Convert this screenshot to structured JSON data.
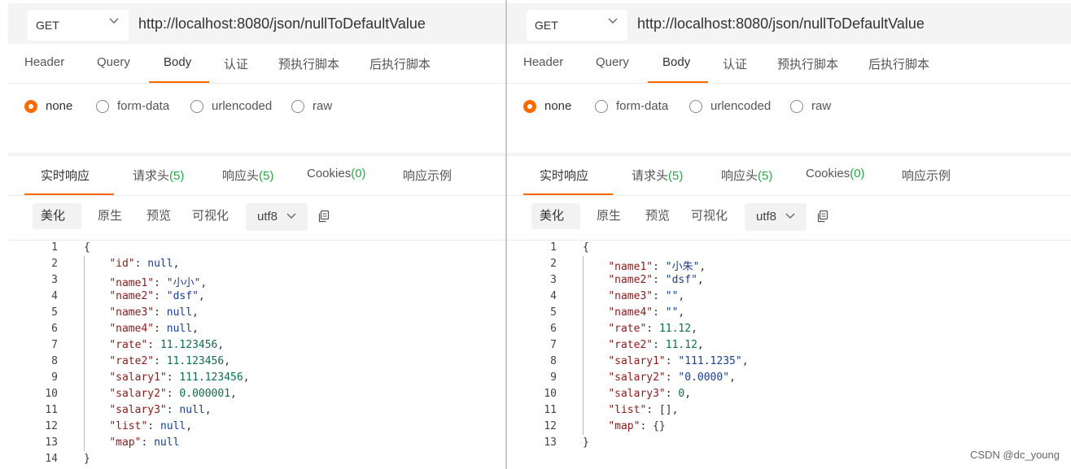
{
  "left": {
    "method": "GET",
    "url": "http://localhost:8080/json/nullToDefaultValue",
    "request_tabs": [
      {
        "label": "Header"
      },
      {
        "label": "Query"
      },
      {
        "label": "Body"
      },
      {
        "label": "认证"
      },
      {
        "label": "预执行脚本"
      },
      {
        "label": "后执行脚本"
      }
    ],
    "active_request_tab": "Body",
    "body_types": [
      {
        "label": "none"
      },
      {
        "label": "form-data"
      },
      {
        "label": "urlencoded"
      },
      {
        "label": "raw"
      }
    ],
    "selected_body_type": "none",
    "response_tabs": [
      {
        "label": "实时响应",
        "count": ""
      },
      {
        "label": "请求头",
        "count": "(5)"
      },
      {
        "label": "响应头",
        "count": "(5)"
      },
      {
        "label": "Cookies",
        "count": "(0)"
      },
      {
        "label": "响应示例",
        "count": ""
      }
    ],
    "active_response_tab": "实时响应",
    "view_buttons": [
      {
        "label": "美化"
      },
      {
        "label": "原生"
      },
      {
        "label": "预览"
      },
      {
        "label": "可视化"
      }
    ],
    "active_view": "美化",
    "encoding": "utf8",
    "code_lines": [
      {
        "num": "1",
        "tokens": [
          {
            "t": "p",
            "v": "{"
          }
        ]
      },
      {
        "num": "2",
        "tokens": [
          {
            "t": "p",
            "v": "    "
          },
          {
            "t": "k",
            "v": "\"id\""
          },
          {
            "t": "p",
            "v": ": "
          },
          {
            "t": "nl",
            "v": "null"
          },
          {
            "t": "p",
            "v": ","
          }
        ]
      },
      {
        "num": "3",
        "tokens": [
          {
            "t": "p",
            "v": "    "
          },
          {
            "t": "k",
            "v": "\"name1\""
          },
          {
            "t": "p",
            "v": ": "
          },
          {
            "t": "s",
            "v": "\"小小\""
          },
          {
            "t": "p",
            "v": ","
          }
        ]
      },
      {
        "num": "4",
        "tokens": [
          {
            "t": "p",
            "v": "    "
          },
          {
            "t": "k",
            "v": "\"name2\""
          },
          {
            "t": "p",
            "v": ": "
          },
          {
            "t": "s",
            "v": "\"dsf\""
          },
          {
            "t": "p",
            "v": ","
          }
        ]
      },
      {
        "num": "5",
        "tokens": [
          {
            "t": "p",
            "v": "    "
          },
          {
            "t": "k",
            "v": "\"name3\""
          },
          {
            "t": "p",
            "v": ": "
          },
          {
            "t": "nl",
            "v": "null"
          },
          {
            "t": "p",
            "v": ","
          }
        ]
      },
      {
        "num": "6",
        "tokens": [
          {
            "t": "p",
            "v": "    "
          },
          {
            "t": "k",
            "v": "\"name4\""
          },
          {
            "t": "p",
            "v": ": "
          },
          {
            "t": "nl",
            "v": "null"
          },
          {
            "t": "p",
            "v": ","
          }
        ]
      },
      {
        "num": "7",
        "tokens": [
          {
            "t": "p",
            "v": "    "
          },
          {
            "t": "k",
            "v": "\"rate\""
          },
          {
            "t": "p",
            "v": ": "
          },
          {
            "t": "n",
            "v": "11.123456"
          },
          {
            "t": "p",
            "v": ","
          }
        ]
      },
      {
        "num": "8",
        "tokens": [
          {
            "t": "p",
            "v": "    "
          },
          {
            "t": "k",
            "v": "\"rate2\""
          },
          {
            "t": "p",
            "v": ": "
          },
          {
            "t": "n",
            "v": "11.123456"
          },
          {
            "t": "p",
            "v": ","
          }
        ]
      },
      {
        "num": "9",
        "tokens": [
          {
            "t": "p",
            "v": "    "
          },
          {
            "t": "k",
            "v": "\"salary1\""
          },
          {
            "t": "p",
            "v": ": "
          },
          {
            "t": "n",
            "v": "111.123456"
          },
          {
            "t": "p",
            "v": ","
          }
        ]
      },
      {
        "num": "10",
        "tokens": [
          {
            "t": "p",
            "v": "    "
          },
          {
            "t": "k",
            "v": "\"salary2\""
          },
          {
            "t": "p",
            "v": ": "
          },
          {
            "t": "n",
            "v": "0.000001"
          },
          {
            "t": "p",
            "v": ","
          }
        ]
      },
      {
        "num": "11",
        "tokens": [
          {
            "t": "p",
            "v": "    "
          },
          {
            "t": "k",
            "v": "\"salary3\""
          },
          {
            "t": "p",
            "v": ": "
          },
          {
            "t": "nl",
            "v": "null"
          },
          {
            "t": "p",
            "v": ","
          }
        ]
      },
      {
        "num": "12",
        "tokens": [
          {
            "t": "p",
            "v": "    "
          },
          {
            "t": "k",
            "v": "\"list\""
          },
          {
            "t": "p",
            "v": ": "
          },
          {
            "t": "nl",
            "v": "null"
          },
          {
            "t": "p",
            "v": ","
          }
        ]
      },
      {
        "num": "13",
        "tokens": [
          {
            "t": "p",
            "v": "    "
          },
          {
            "t": "k",
            "v": "\"map\""
          },
          {
            "t": "p",
            "v": ": "
          },
          {
            "t": "nl",
            "v": "null"
          }
        ]
      },
      {
        "num": "14",
        "tokens": [
          {
            "t": "p",
            "v": "}"
          }
        ]
      }
    ]
  },
  "right": {
    "method": "GET",
    "url": "http://localhost:8080/json/nullToDefaultValue",
    "request_tabs": [
      {
        "label": "Header"
      },
      {
        "label": "Query"
      },
      {
        "label": "Body"
      },
      {
        "label": "认证"
      },
      {
        "label": "预执行脚本"
      },
      {
        "label": "后执行脚本"
      }
    ],
    "active_request_tab": "Body",
    "body_types": [
      {
        "label": "none"
      },
      {
        "label": "form-data"
      },
      {
        "label": "urlencoded"
      },
      {
        "label": "raw"
      }
    ],
    "selected_body_type": "none",
    "response_tabs": [
      {
        "label": "实时响应",
        "count": ""
      },
      {
        "label": "请求头",
        "count": "(5)"
      },
      {
        "label": "响应头",
        "count": "(5)"
      },
      {
        "label": "Cookies",
        "count": "(0)"
      },
      {
        "label": "响应示例",
        "count": ""
      }
    ],
    "active_response_tab": "实时响应",
    "view_buttons": [
      {
        "label": "美化"
      },
      {
        "label": "原生"
      },
      {
        "label": "预览"
      },
      {
        "label": "可视化"
      }
    ],
    "active_view": "美化",
    "encoding": "utf8",
    "code_lines": [
      {
        "num": "1",
        "tokens": [
          {
            "t": "p",
            "v": "{"
          }
        ]
      },
      {
        "num": "2",
        "tokens": [
          {
            "t": "p",
            "v": "    "
          },
          {
            "t": "k",
            "v": "\"name1\""
          },
          {
            "t": "p",
            "v": ": "
          },
          {
            "t": "s",
            "v": "\"小朱\""
          },
          {
            "t": "p",
            "v": ","
          }
        ]
      },
      {
        "num": "3",
        "tokens": [
          {
            "t": "p",
            "v": "    "
          },
          {
            "t": "k",
            "v": "\"name2\""
          },
          {
            "t": "p",
            "v": ": "
          },
          {
            "t": "s",
            "v": "\"dsf\""
          },
          {
            "t": "p",
            "v": ","
          }
        ]
      },
      {
        "num": "4",
        "tokens": [
          {
            "t": "p",
            "v": "    "
          },
          {
            "t": "k",
            "v": "\"name3\""
          },
          {
            "t": "p",
            "v": ": "
          },
          {
            "t": "s",
            "v": "\"\""
          },
          {
            "t": "p",
            "v": ","
          }
        ]
      },
      {
        "num": "5",
        "tokens": [
          {
            "t": "p",
            "v": "    "
          },
          {
            "t": "k",
            "v": "\"name4\""
          },
          {
            "t": "p",
            "v": ": "
          },
          {
            "t": "s",
            "v": "\"\""
          },
          {
            "t": "p",
            "v": ","
          }
        ]
      },
      {
        "num": "6",
        "tokens": [
          {
            "t": "p",
            "v": "    "
          },
          {
            "t": "k",
            "v": "\"rate\""
          },
          {
            "t": "p",
            "v": ": "
          },
          {
            "t": "n",
            "v": "11.12"
          },
          {
            "t": "p",
            "v": ","
          }
        ]
      },
      {
        "num": "7",
        "tokens": [
          {
            "t": "p",
            "v": "    "
          },
          {
            "t": "k",
            "v": "\"rate2\""
          },
          {
            "t": "p",
            "v": ": "
          },
          {
            "t": "n",
            "v": "11.12"
          },
          {
            "t": "p",
            "v": ","
          }
        ]
      },
      {
        "num": "8",
        "tokens": [
          {
            "t": "p",
            "v": "    "
          },
          {
            "t": "k",
            "v": "\"salary1\""
          },
          {
            "t": "p",
            "v": ": "
          },
          {
            "t": "s",
            "v": "\"111.1235\""
          },
          {
            "t": "p",
            "v": ","
          }
        ]
      },
      {
        "num": "9",
        "tokens": [
          {
            "t": "p",
            "v": "    "
          },
          {
            "t": "k",
            "v": "\"salary2\""
          },
          {
            "t": "p",
            "v": ": "
          },
          {
            "t": "s",
            "v": "\"0.0000\""
          },
          {
            "t": "p",
            "v": ","
          }
        ]
      },
      {
        "num": "10",
        "tokens": [
          {
            "t": "p",
            "v": "    "
          },
          {
            "t": "k",
            "v": "\"salary3\""
          },
          {
            "t": "p",
            "v": ": "
          },
          {
            "t": "n",
            "v": "0"
          },
          {
            "t": "p",
            "v": ","
          }
        ]
      },
      {
        "num": "11",
        "tokens": [
          {
            "t": "p",
            "v": "    "
          },
          {
            "t": "k",
            "v": "\"list\""
          },
          {
            "t": "p",
            "v": ": [],"
          }
        ]
      },
      {
        "num": "12",
        "tokens": [
          {
            "t": "p",
            "v": "    "
          },
          {
            "t": "k",
            "v": "\"map\""
          },
          {
            "t": "p",
            "v": ": {}"
          }
        ]
      },
      {
        "num": "13",
        "tokens": [
          {
            "t": "p",
            "v": "}"
          }
        ]
      }
    ]
  },
  "watermark": "CSDN @dc_young",
  "colors": {
    "accent": "#ff6a00",
    "count_green": "#27a745",
    "json_key": "#8b1a1a",
    "json_string": "#1a3d8f",
    "json_number": "#0b6e4f"
  },
  "icons": {
    "method_dropdown": "chevron-down-icon",
    "encoding_dropdown": "chevron-down-icon",
    "copy": "copy-icon"
  }
}
